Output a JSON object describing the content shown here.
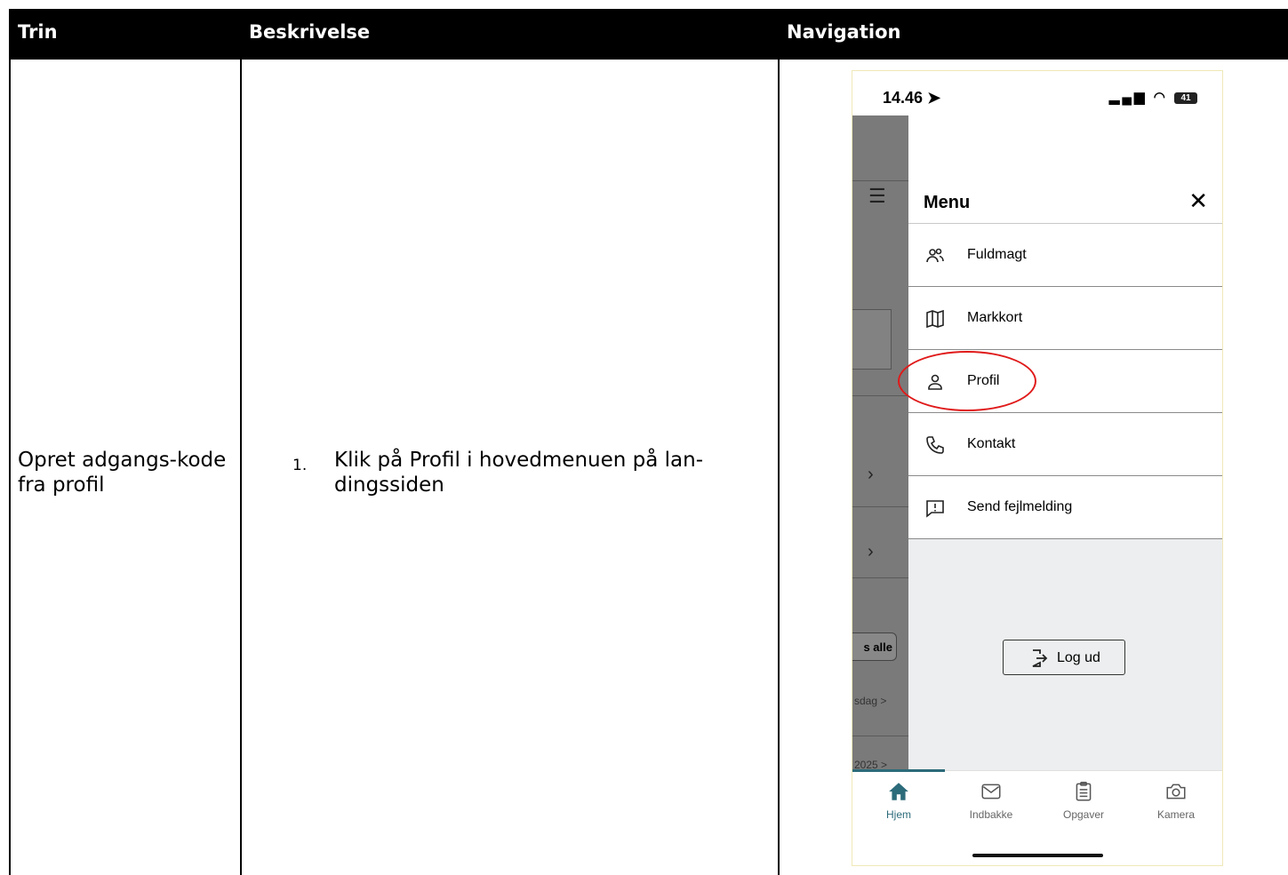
{
  "table": {
    "headers": {
      "trin": "Trin",
      "beskrivelse": "Beskrivelse",
      "navigation": "Navigation"
    },
    "row": {
      "trin": "Opret adgangs-kode fra profil",
      "step_number": "1.",
      "beskrivelse": "Klik på Profil i hovedmenuen på lan-dingssiden"
    }
  },
  "phone": {
    "status_time": "14.46",
    "status_battery": "41",
    "background": {
      "button_label": "s alle",
      "small_text_1": "sdag >",
      "small_text_2": "2025 >"
    },
    "menu": {
      "title": "Menu",
      "items": [
        {
          "label": "Fuldmagt",
          "icon": "people-icon"
        },
        {
          "label": "Markkort",
          "icon": "map-icon"
        },
        {
          "label": "Profil",
          "icon": "person-icon"
        },
        {
          "label": "Kontakt",
          "icon": "phone-icon"
        },
        {
          "label": "Send fejlmelding",
          "icon": "alert-message-icon"
        }
      ],
      "logout_label": "Log ud"
    },
    "tabs": [
      {
        "label": "Hjem",
        "icon": "home-icon",
        "active": true
      },
      {
        "label": "Indbakke",
        "icon": "mail-icon",
        "active": false
      },
      {
        "label": "Opgaver",
        "icon": "clipboard-icon",
        "active": false
      },
      {
        "label": "Kamera",
        "icon": "camera-icon",
        "active": false
      }
    ],
    "colors": {
      "accent": "#2c6b7a",
      "highlight": "#e01a1a"
    }
  }
}
